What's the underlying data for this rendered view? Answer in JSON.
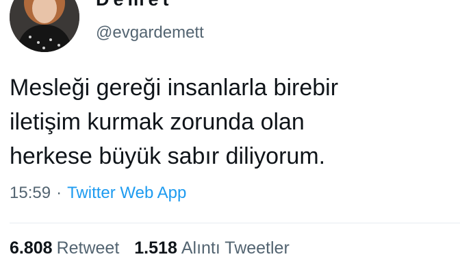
{
  "user": {
    "display_name": "Demet",
    "handle": "@evgardemett"
  },
  "tweet": {
    "lines": [
      "Mesleği gereği insanlarla birebir",
      "iletişim kurmak zorunda olan",
      "herkese büyük sabır diliyorum."
    ],
    "time": "15:59",
    "separator": "·",
    "source": "Twitter Web App"
  },
  "stats": {
    "retweets": {
      "count": "6.808",
      "label": "Retweet"
    },
    "quotes": {
      "count": "1.518",
      "label": "Alıntı Tweetler"
    }
  },
  "colors": {
    "text": "#0f1419",
    "secondary": "#536471",
    "link": "#1d9bf0",
    "divider": "#e6ecf0"
  }
}
